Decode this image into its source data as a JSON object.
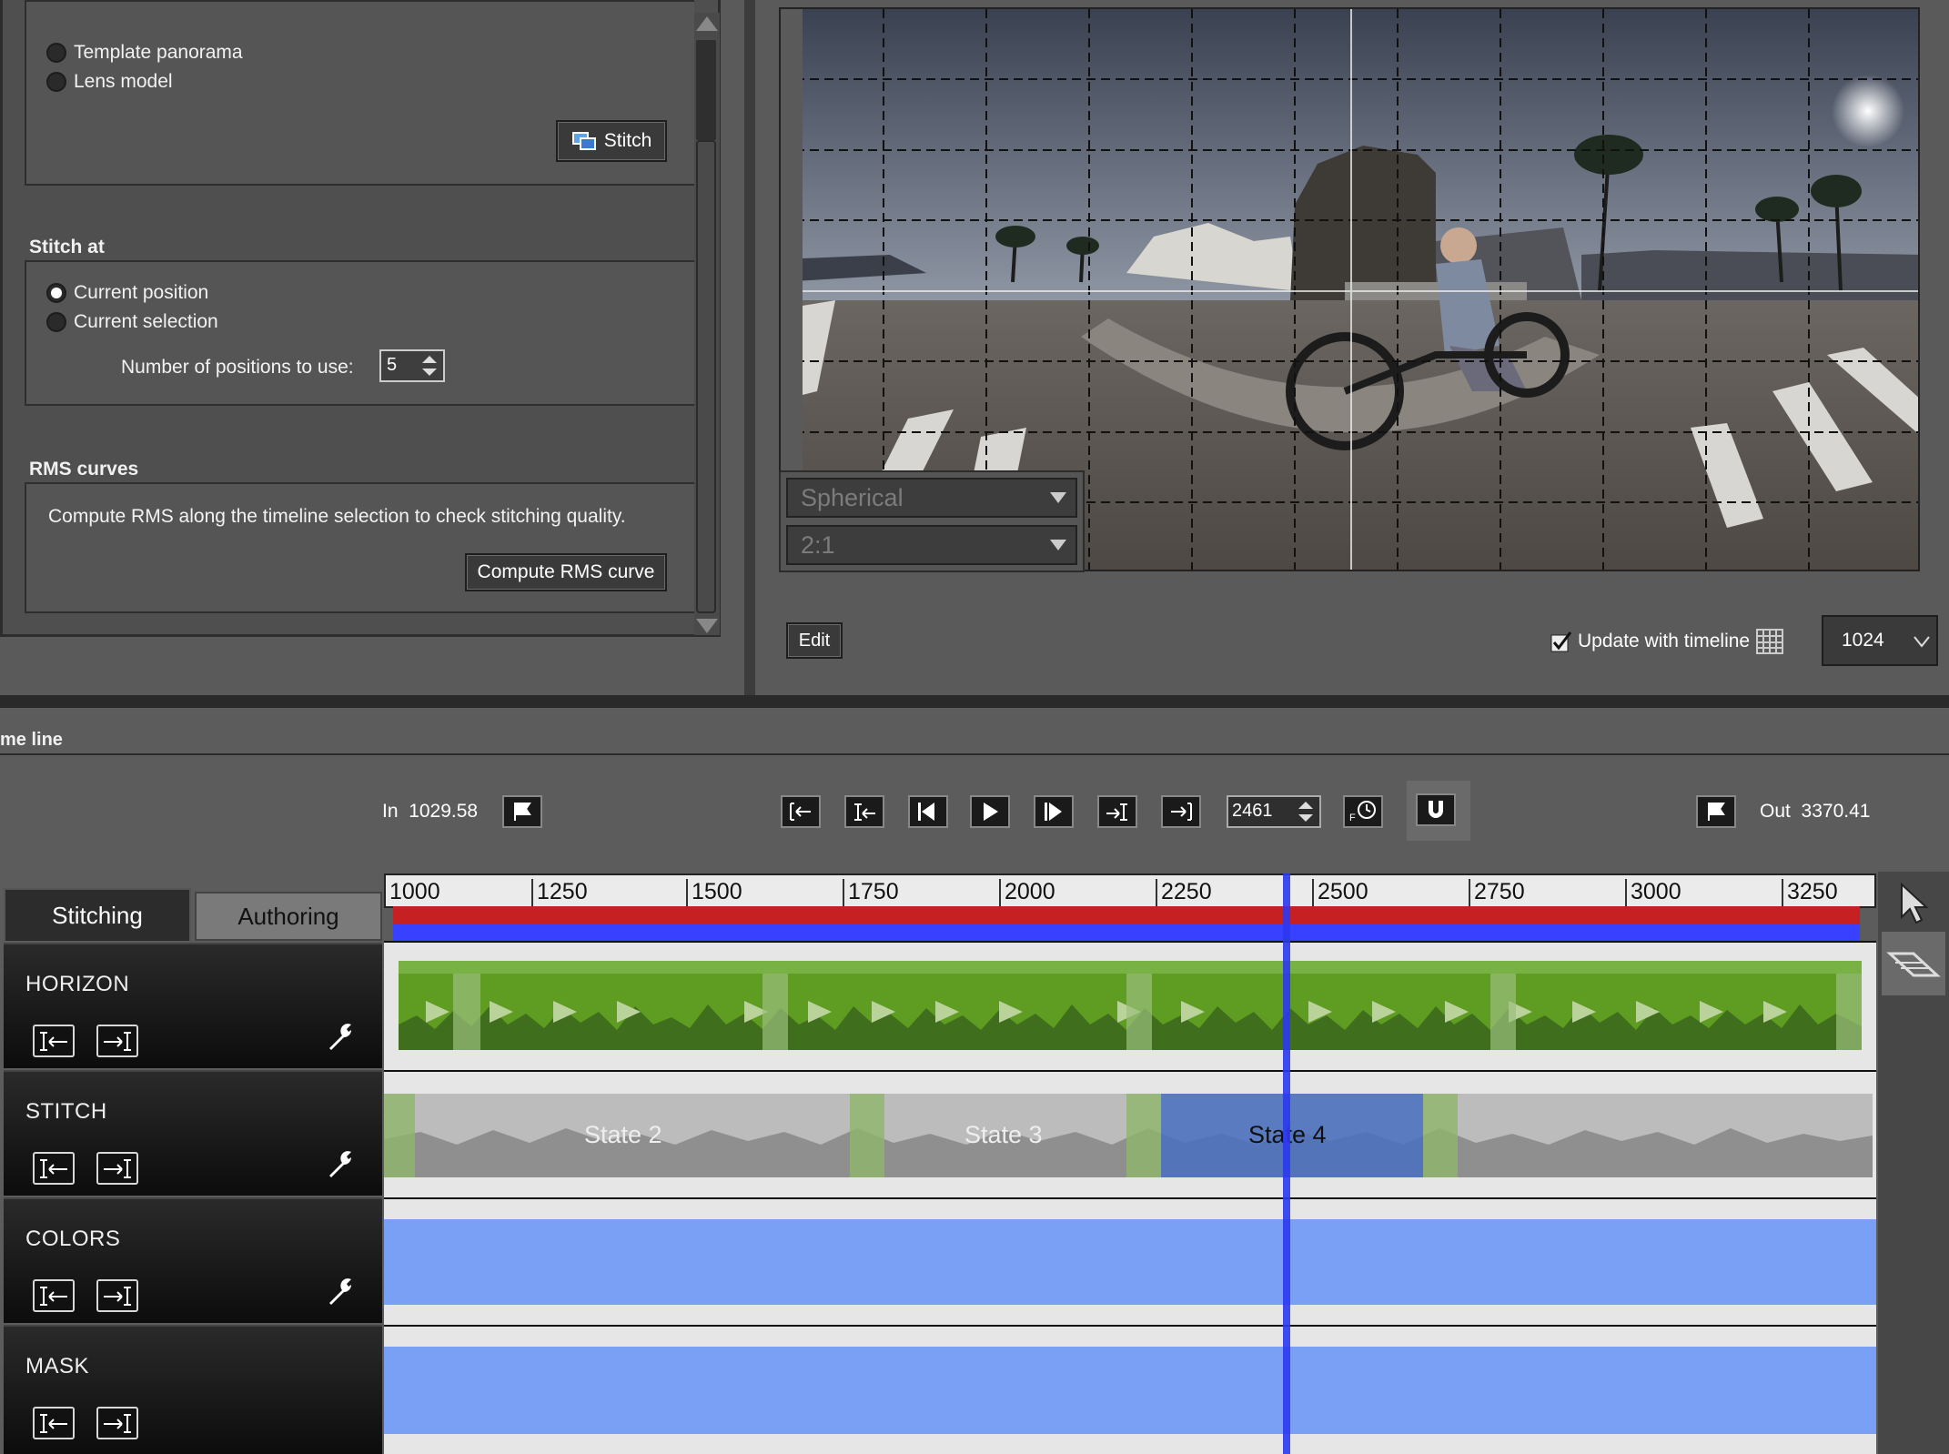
{
  "stitch_panel": {
    "options": [
      "Template panorama",
      "Lens model"
    ],
    "stitch_button": "Stitch"
  },
  "stitch_at": {
    "title": "Stitch at",
    "options": [
      "Current position",
      "Current selection"
    ],
    "selected": "Current position",
    "positions_label": "Number of positions to use:",
    "positions_value": "5"
  },
  "rms": {
    "title": "RMS curves",
    "description": "Compute RMS along the timeline selection to check stitching quality.",
    "button": "Compute RMS curve"
  },
  "preview": {
    "projection": "Spherical",
    "aspect": "2:1",
    "edit_button": "Edit",
    "update_label": "Update with timeline",
    "update_checked": true,
    "resolution": "1024"
  },
  "timeline": {
    "title": "me line",
    "in_label": "In",
    "in_value": "1029.58",
    "out_label": "Out",
    "out_value": "3370.41",
    "frame": "2461",
    "ruler_ticks": [
      "1000",
      "1250",
      "1500",
      "1750",
      "2000",
      "2250",
      "2500",
      "2750",
      "3000",
      "3250"
    ],
    "tabs": [
      "Stitching",
      "Authoring"
    ],
    "active_tab": "Stitching",
    "tracks": [
      "HORIZON",
      "STITCH",
      "COLORS",
      "MASK"
    ],
    "stitch_states": [
      "State 2",
      "State 3",
      "State 4"
    ]
  },
  "colors": {
    "panel_bg": "#5a5a5a",
    "horizon_green": "#6aa32a",
    "lane_blue": "#7aa0f5",
    "playhead": "#2c38ee",
    "in_bar": "#c72023",
    "out_bar": "#3841ff"
  }
}
